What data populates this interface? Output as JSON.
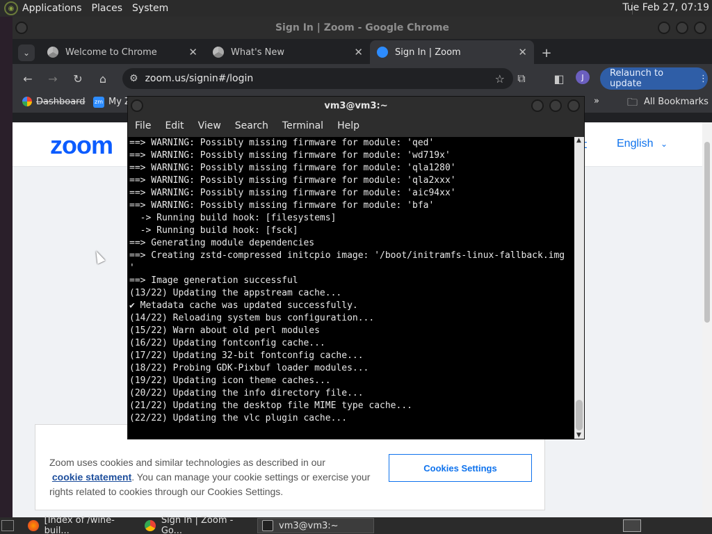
{
  "top_panel": {
    "menus": [
      "Applications",
      "Places",
      "System"
    ],
    "clock": "Tue Feb 27, 07:19"
  },
  "chrome": {
    "window_title": "Sign In | Zoom - Google Chrome",
    "tabs": [
      {
        "label": "Welcome to Chrome",
        "icon": "chrome-icon"
      },
      {
        "label": "What's New",
        "icon": "chrome-icon"
      },
      {
        "label": "Sign In | Zoom",
        "icon": "zoom-icon"
      }
    ],
    "new_tab": "+",
    "url": "zoom.us/signin#/login",
    "relaunch_label": "Relaunch to update",
    "avatar_letter": "J",
    "bookmarks": {
      "items": [
        "Dashboard",
        "My Z"
      ],
      "all_bookmarks": "All Bookmarks"
    }
  },
  "zoom_page": {
    "logo": "zoom",
    "partial_link": "t",
    "language": "English",
    "cookie_text_1": "Zoom uses cookies and similar technologies as described in our",
    "cookie_link": "cookie statement",
    "cookie_text_2": ". You can manage your cookie settings or exercise your rights related to cookies through our Cookies Settings.",
    "cookie_button": "Cookies Settings"
  },
  "terminal": {
    "title": "vm3@vm3:~",
    "menu": [
      "File",
      "Edit",
      "View",
      "Search",
      "Terminal",
      "Help"
    ],
    "lines": [
      "==> WARNING: Possibly missing firmware for module: 'qed'",
      "==> WARNING: Possibly missing firmware for module: 'wd719x'",
      "==> WARNING: Possibly missing firmware for module: 'qla1280'",
      "==> WARNING: Possibly missing firmware for module: 'qla2xxx'",
      "==> WARNING: Possibly missing firmware for module: 'aic94xx'",
      "==> WARNING: Possibly missing firmware for module: 'bfa'",
      "  -> Running build hook: [filesystems]",
      "  -> Running build hook: [fsck]",
      "==> Generating module dependencies",
      "==> Creating zstd-compressed initcpio image: '/boot/initramfs-linux-fallback.img",
      "'",
      "==> Image generation successful",
      "(13/22) Updating the appstream cache...",
      "✔ Metadata cache was updated successfully.",
      "(14/22) Reloading system bus configuration...",
      "(15/22) Warn about old perl modules",
      "(16/22) Updating fontconfig cache...",
      "(17/22) Updating 32-bit fontconfig cache...",
      "(18/22) Probing GDK-Pixbuf loader modules...",
      "(19/22) Updating icon theme caches...",
      "(20/22) Updating the info directory file...",
      "(21/22) Updating the desktop file MIME type cache...",
      "(22/22) Updating the vlc plugin cache..."
    ]
  },
  "taskbar": {
    "items": [
      {
        "label": "[Index of /wine-buil...",
        "icon": "firefox-icon"
      },
      {
        "label": "Sign In | Zoom - Go...",
        "icon": "chrome-icon"
      },
      {
        "label": "vm3@vm3:~",
        "icon": "terminal-icon"
      }
    ]
  },
  "colors": {
    "zoom_blue": "#0b5cff",
    "relaunch_bg": "#2f5ea7",
    "terminal_bg": "#000000"
  }
}
